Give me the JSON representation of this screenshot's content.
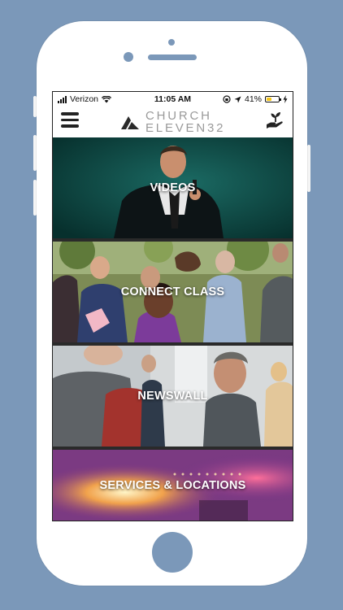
{
  "status_bar": {
    "carrier": "Verizon",
    "time": "11:05 AM",
    "battery": "41%",
    "battery_level": 0.41,
    "icons": [
      "signal-bars-icon",
      "wifi-icon",
      "rotation-lock-icon",
      "location-arrow-icon",
      "battery-icon",
      "charging-bolt-icon"
    ]
  },
  "header": {
    "logo_line1": "CHURCH",
    "logo_line2": "ELEVEN32",
    "menu_icon": "hamburger-menu-icon",
    "give_icon": "giving-hand-plant-icon"
  },
  "tiles": [
    {
      "label": "VIDEOS"
    },
    {
      "label": "CONNECT CLASS"
    },
    {
      "label": "NEWSWALL"
    },
    {
      "label": "SERVICES & LOCATIONS"
    }
  ],
  "colors": {
    "frame_background": "#7b98b9",
    "logo_gray": "#9a9a9a",
    "videos_teal": "#0f4e4a",
    "battery_yellow": "#f4c51a"
  }
}
